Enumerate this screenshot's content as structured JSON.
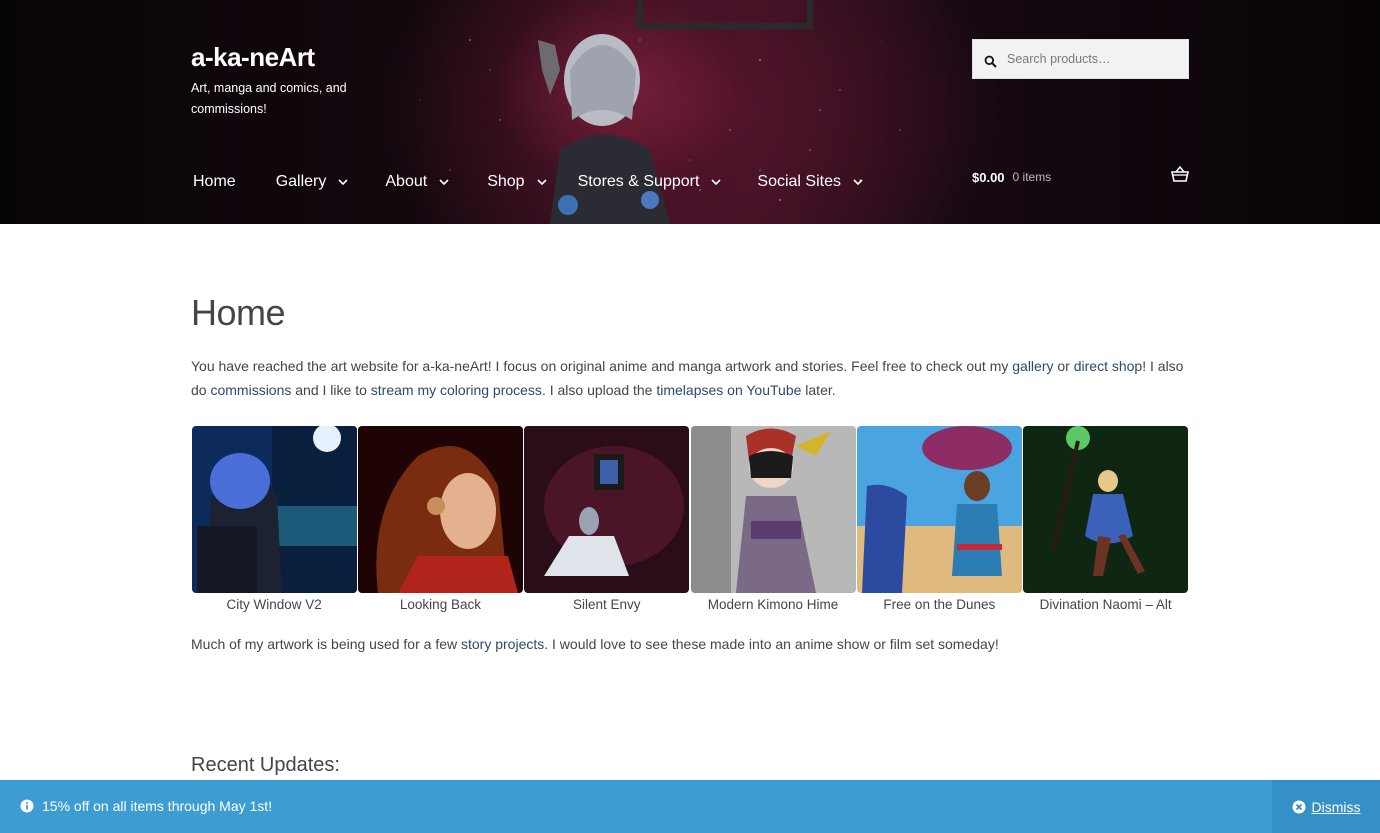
{
  "header": {
    "site_title": "a-ka-neArt",
    "tagline": "Art, manga and comics, and commissions!",
    "search": {
      "placeholder": "Search products…"
    },
    "nav": [
      {
        "label": "Home",
        "has_dropdown": false
      },
      {
        "label": "Gallery",
        "has_dropdown": true
      },
      {
        "label": "About",
        "has_dropdown": true
      },
      {
        "label": "Shop",
        "has_dropdown": true
      },
      {
        "label": "Stores & Support",
        "has_dropdown": true
      },
      {
        "label": "Social Sites",
        "has_dropdown": true
      }
    ],
    "cart": {
      "amount": "$0.00",
      "items": "0 items"
    }
  },
  "page": {
    "title": "Home",
    "intro": {
      "t1": "You have reached the art website for a-ka-neArt!  I focus on original anime and manga artwork and stories.  Feel free to check out my ",
      "link_gallery": "gallery",
      "t2": " or ",
      "link_shop": "direct shop",
      "t3": "!  I also do ",
      "link_commissions": "commissions",
      "t4": " and I like to ",
      "link_stream": "stream my coloring process",
      "t5": ".  I also upload the ",
      "link_timelapses": "timelapses on YouTube",
      "t6": " later."
    },
    "gallery": [
      {
        "caption": "City Window V2"
      },
      {
        "caption": "Looking Back"
      },
      {
        "caption": "Silent Envy"
      },
      {
        "caption": "Modern Kimono Hime"
      },
      {
        "caption": "Free on the Dunes"
      },
      {
        "caption": "Divination Naomi – Alt"
      }
    ],
    "outro": {
      "t1": "Much of my artwork is being used for a few ",
      "link_story": "story projects",
      "t2": ".  I would love to see these made into an anime show or film set someday!"
    },
    "recent_heading": "Recent Updates:"
  },
  "notice": {
    "text": "15% off on all items through May 1st!",
    "dismiss": "Dismiss"
  },
  "colors": {
    "link": "#2c4a6e",
    "notice_bg": "#3d9cd2",
    "dismiss_bg": "#3591c5",
    "text": "#43454b"
  }
}
